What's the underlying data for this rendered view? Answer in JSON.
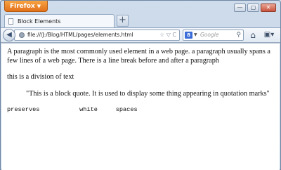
{
  "browser": {
    "menu_label": "Firefox",
    "menu_caret": "▼",
    "tab_title": "Block Elements",
    "new_tab": "+",
    "window_controls": {
      "minimize": "—",
      "restore": "▢",
      "close": "✕"
    },
    "url": "file:///J:/Blog/HTML/pages/elements.html",
    "url_icons": "☆ ▽ C",
    "search_engine_logo": "8",
    "search_engine_caret": "▼",
    "search_placeholder": "Google",
    "icons": {
      "back": "back-arrow-icon",
      "home": "home-icon",
      "bookmarks": "bookmarks-icon",
      "search": "search-icon",
      "globe": "globe-icon"
    }
  },
  "page": {
    "paragraph": "A paragraph is the most commonly used element in a web page. a paragraph usually spans a few lines of a web page. There is a line break before and after a paragraph",
    "division": "this is a division of text",
    "blockquote": "\"This is a block quote. It is used to display some thing appearing in quotation marks\"",
    "preformatted": "preserves           white     spaces"
  },
  "colors": {
    "firefox_button": "#e98a2b",
    "window_frame": "#cfdceb",
    "content_bg": "#ffffff"
  }
}
